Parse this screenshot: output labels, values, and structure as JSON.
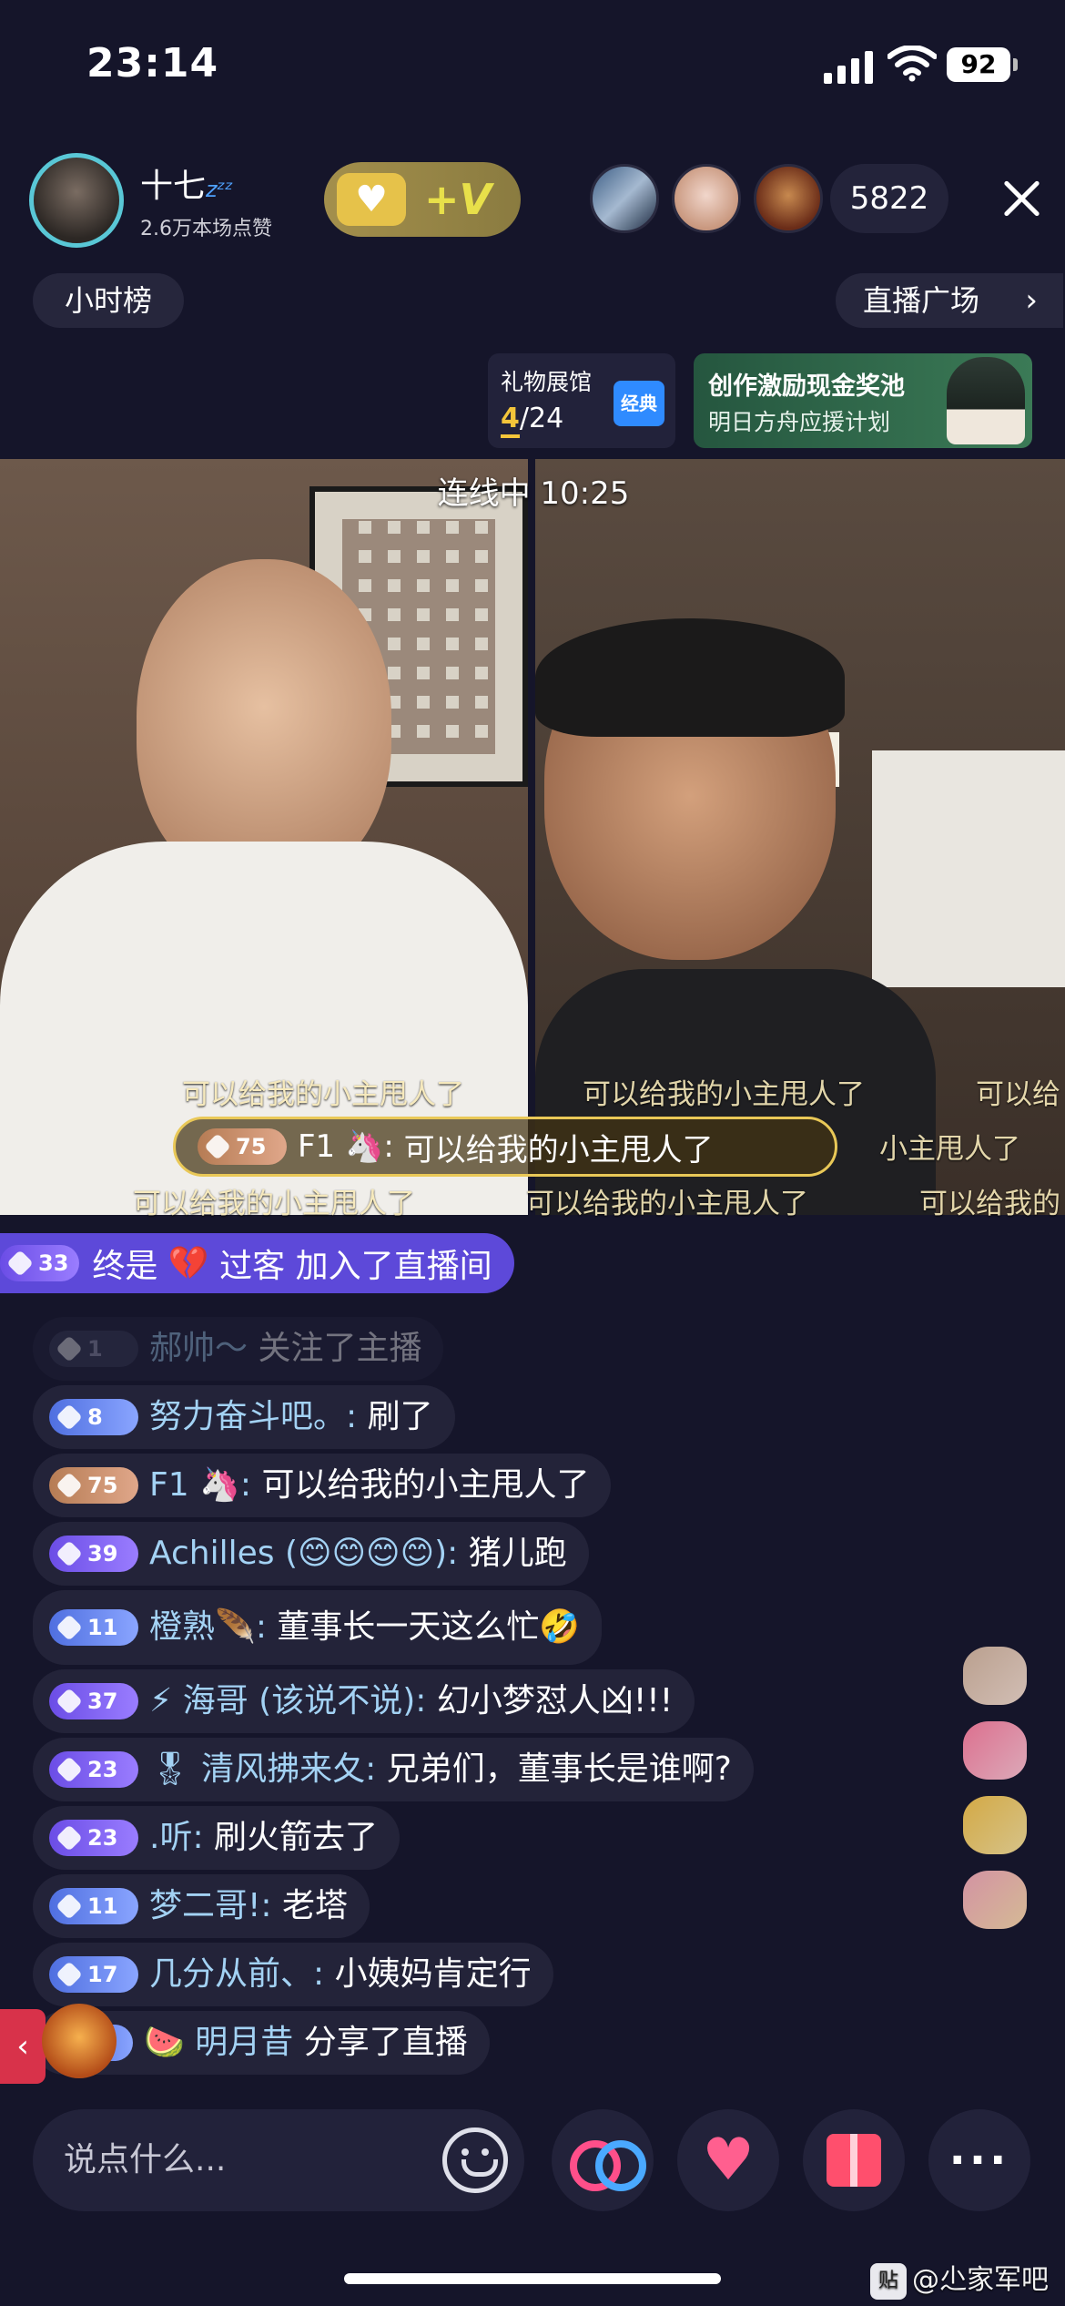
{
  "status_bar": {
    "time": "23:14",
    "battery": "92"
  },
  "host": {
    "name": "十七",
    "sleep_mark": "zᶻᶻ",
    "likes": "2.6万本场点赞"
  },
  "viewers": {
    "count": "5822"
  },
  "top_tabs": {
    "hourly_rank": "小时榜",
    "live_plaza": "直播广场"
  },
  "gift_hall": {
    "title": "礼物展馆",
    "progress_current": "4",
    "progress_total": "/24",
    "badge": "经典"
  },
  "event_banner": {
    "line1": "创作激励现金奖池",
    "line2": "明日方舟应援计划"
  },
  "video": {
    "link_status": "连线中 10:25",
    "scroll_text": [
      "可以给我的小主甩人了",
      "可以给我的小主甩人了",
      "可以给",
      "小主甩人了",
      "可以给我的小主甩人了",
      "可以给我的小主甩人了",
      "可以给我的"
    ],
    "highlight": {
      "level": "75",
      "user": "F1 🦄",
      "msg": "可以给我的小主甩人了"
    }
  },
  "join_notice": {
    "level": "33",
    "user": "终是",
    "user_suffix": "过客",
    "text": "加入了直播间"
  },
  "chat": [
    {
      "level": "1",
      "level_style": "gray",
      "user": "郝帅～",
      "msg": "关注了主播",
      "faded": true
    },
    {
      "level": "8",
      "level_style": "blue",
      "user": "努力奋斗吧。:",
      "msg": "刷了"
    },
    {
      "level": "75",
      "level_style": "gold",
      "user": "F1 🦄:",
      "msg": "可以给我的小主甩人了"
    },
    {
      "level": "39",
      "level_style": "purple",
      "user": "Achilles (😊😊😊😊):",
      "msg": "猪儿跑"
    },
    {
      "level": "11",
      "level_style": "blue",
      "user": "橙熟🪶:",
      "msg": "董事长一天这么忙🤣"
    },
    {
      "level": "37",
      "level_style": "purple",
      "user": "⚡ 海哥 (该说不说):",
      "msg": "幻小梦怼人凶!!!"
    },
    {
      "level": "23",
      "level_style": "purple",
      "user": "🎖 清风拂来夂:",
      "msg": "兄弟们，董事长是谁啊?"
    },
    {
      "level": "23",
      "level_style": "purple",
      "user": ".听:",
      "msg": "刷火箭去了"
    },
    {
      "level": "11",
      "level_style": "blue",
      "user": "梦二哥!:",
      "msg": "老塔"
    },
    {
      "level": "17",
      "level_style": "blue",
      "user": "几分从前、:",
      "msg": "小姨妈肯定行"
    },
    {
      "level": "5",
      "level_style": "blue",
      "user": "🍉 明月昔",
      "msg": "分享了直播"
    }
  ],
  "bottom_bar": {
    "input_placeholder": "说点什么..."
  },
  "watermark": {
    "tb": "贴",
    "text": "@尐家军吧"
  }
}
